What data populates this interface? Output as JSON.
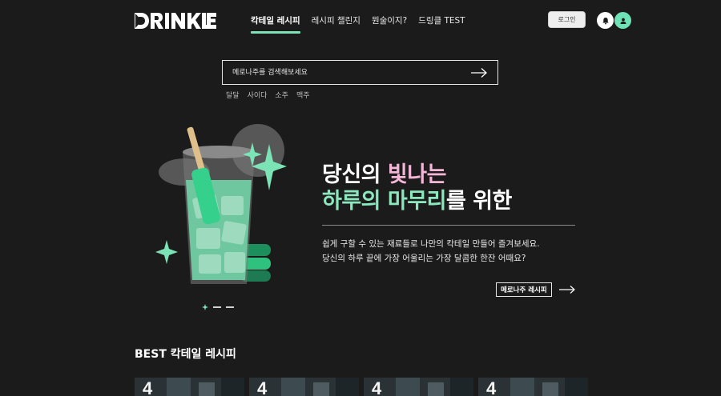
{
  "header": {
    "logo_text": "DRINKLE",
    "nav": [
      {
        "label": "칵테일 레시피",
        "active": true
      },
      {
        "label": "레시피 챌린지",
        "active": false
      },
      {
        "label": "뭔술이지?",
        "active": false
      },
      {
        "label": "드링클 TEST",
        "active": false
      }
    ],
    "login_label": "로그인",
    "icons": [
      "bell-icon",
      "user-icon"
    ],
    "accent_color": "#6ee3b6"
  },
  "search": {
    "placeholder": "메로나주를 검색해보세요",
    "value": "",
    "tags": [
      "달달",
      "사이다",
      "소주",
      "맥주"
    ]
  },
  "hero": {
    "title_line1": [
      {
        "text": "당신의 ",
        "color": "#ffffff"
      },
      {
        "text": "빛나는",
        "color": "#f4b6d7"
      }
    ],
    "title_line2": [
      {
        "text": "하루의 마무리",
        "color": "#8be7bd"
      },
      {
        "text": "를 위한",
        "color": "#ffffff"
      }
    ],
    "description": [
      "쉽게 구할 수 있는 재료들로 나만의 칵테일 만들어 즐겨보세요.",
      "당신의 하루 끝에 가장 어울리는 가장 달콤한 한잔 어때요?"
    ],
    "cta_label": "메로나주 레시피",
    "carousel_total": 3,
    "carousel_active": 1
  },
  "best": {
    "title": "BEST 칵테일 레시피",
    "cards": [
      {
        "rank": "4"
      },
      {
        "rank": "4"
      },
      {
        "rank": "4"
      },
      {
        "rank": "4"
      }
    ]
  }
}
